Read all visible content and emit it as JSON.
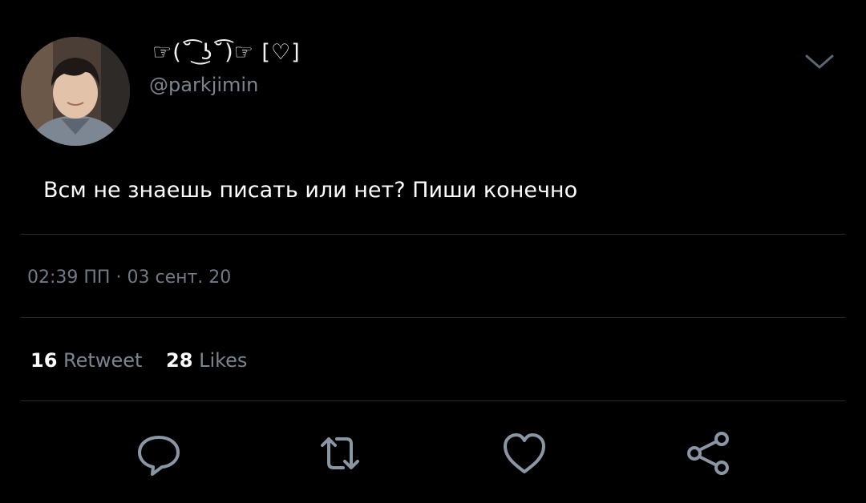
{
  "user": {
    "display_name": "☞(˘͡ ͜ʖ˘͡)☞ [♡]",
    "handle": "@parkjimin"
  },
  "tweet": {
    "text": "Всм не знаешь писать или нет? Пиши конечно",
    "time": "02:39 ПП",
    "separator": "·",
    "date": "03 сент. 20"
  },
  "stats": {
    "retweets_count": "16",
    "retweets_label": "Retweet",
    "likes_count": "28",
    "likes_label": "Likes"
  },
  "colors": {
    "background": "#000000",
    "text_primary": "#ffffff",
    "text_secondary": "#7b8590",
    "icon": "#8a96a3",
    "divider": "#2a2e33"
  },
  "icons": {
    "menu": "chevron-down-icon",
    "reply": "reply-icon",
    "retweet": "retweet-icon",
    "like": "heart-icon",
    "share": "share-icon"
  }
}
